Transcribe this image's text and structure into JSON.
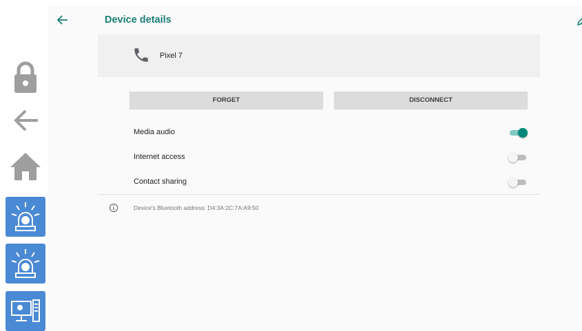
{
  "sidebar": {
    "buttons": [
      {
        "icon": "lock-icon"
      },
      {
        "icon": "back-arrow-icon"
      },
      {
        "icon": "home-icon"
      },
      {
        "icon": "alarm-light-icon"
      },
      {
        "icon": "alarm-light-icon"
      },
      {
        "icon": "computer-icon"
      }
    ],
    "accent": "#4a8ad4"
  },
  "header": {
    "title": "Device details",
    "back_icon": "back-arrow-icon",
    "edit_icon": "edit-icon"
  },
  "device": {
    "name": "Pixel 7",
    "icon": "phone-icon"
  },
  "actions": {
    "forget_label": "FORGET",
    "disconnect_label": "DISCONNECT"
  },
  "settings": [
    {
      "label": "Media audio",
      "enabled": true
    },
    {
      "label": "Internet access",
      "enabled": false
    },
    {
      "label": "Contact sharing",
      "enabled": false
    }
  ],
  "info": {
    "address_text": "Device's Bluetooth address: D4:3A:2C:7A:A9:50",
    "icon": "info-icon"
  },
  "colors": {
    "accent": "#1a7f74",
    "toggle_on": "#00897b"
  }
}
